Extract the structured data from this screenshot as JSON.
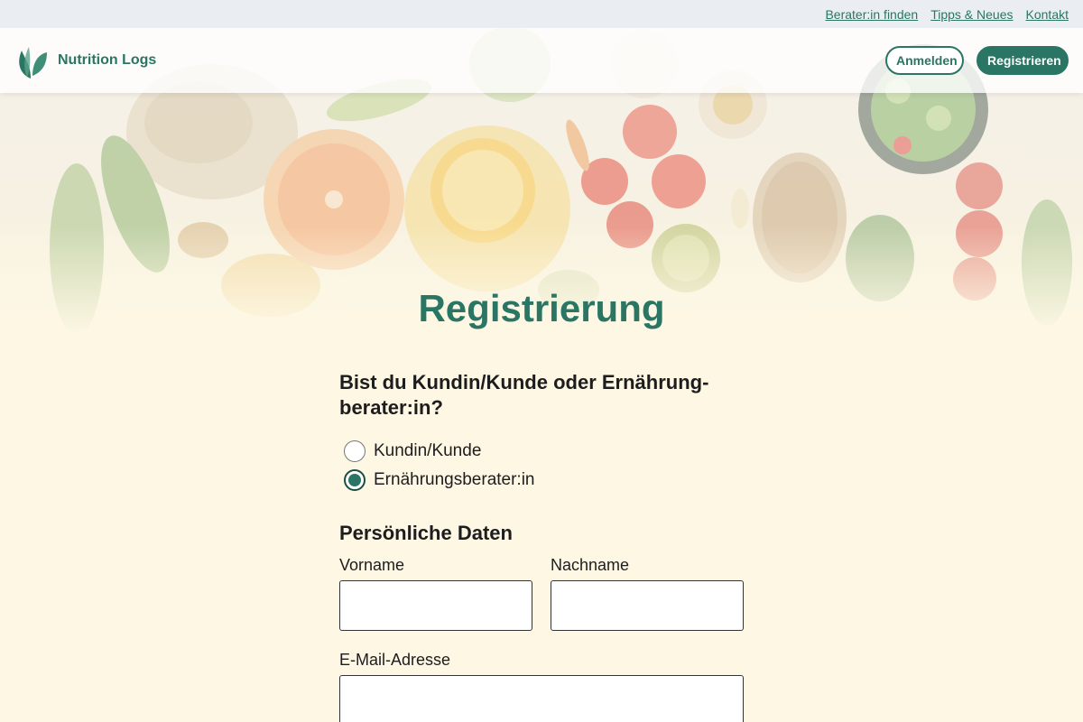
{
  "utility_nav": {
    "links": [
      "Berater:in finden",
      "Tipps & Neues",
      "Kontakt"
    ]
  },
  "header": {
    "brand": "Nutrition Logs",
    "login_label": "Anmelden",
    "register_label": "Registrieren"
  },
  "page": {
    "title": "Registrierung"
  },
  "form": {
    "role_question": "Bist du Kundin/Kunde oder Ernährung-berater:in?",
    "role_options": [
      {
        "label": "Kundin/Kunde",
        "checked": false
      },
      {
        "label": "Ernährungsberater:in",
        "checked": true
      }
    ],
    "personal_section_title": "Persönliche Daten",
    "first_name_label": "Vorname",
    "first_name_value": "",
    "last_name_label": "Nachname",
    "last_name_value": "",
    "email_label": "E-Mail-Adresse",
    "email_value": ""
  },
  "colors": {
    "brand_green": "#2a7563",
    "page_background": "#fdf7e4",
    "utility_bar": "#eaeef2"
  }
}
